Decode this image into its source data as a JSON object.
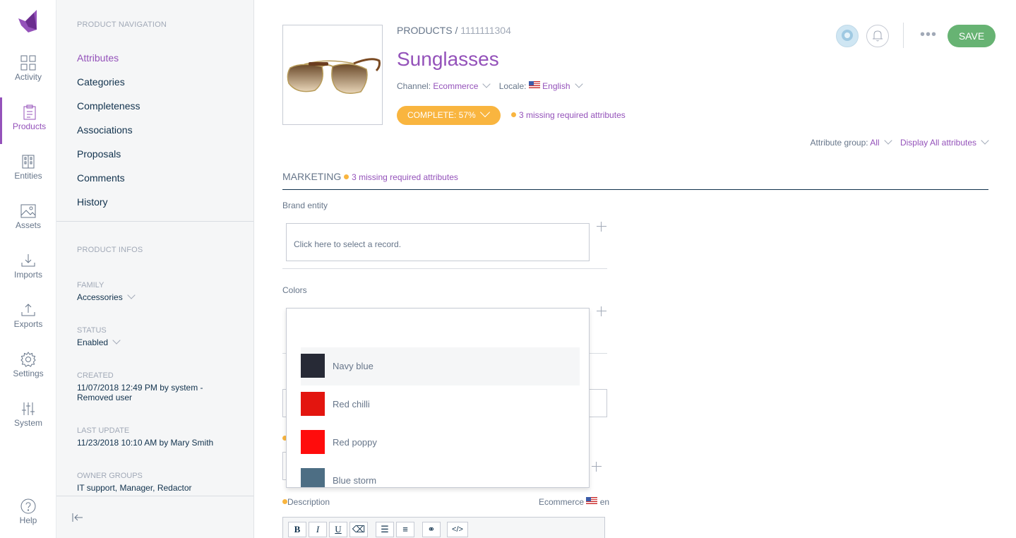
{
  "colors": {
    "accent": "#9452ba",
    "save": "#67b373",
    "warning": "#f9b53f",
    "text": "#67768a",
    "dark": "#11324d"
  },
  "mainmenu": {
    "items": [
      {
        "label": "Activity",
        "icon": "activity-icon"
      },
      {
        "label": "Products",
        "icon": "products-icon",
        "active": true
      },
      {
        "label": "Entities",
        "icon": "entities-icon"
      },
      {
        "label": "Assets",
        "icon": "assets-icon"
      },
      {
        "label": "Imports",
        "icon": "imports-icon"
      },
      {
        "label": "Exports",
        "icon": "exports-icon"
      },
      {
        "label": "Settings",
        "icon": "settings-icon"
      },
      {
        "label": "System",
        "icon": "system-icon"
      }
    ],
    "help": "Help"
  },
  "column": {
    "nav_title": "PRODUCT NAVIGATION",
    "nav": [
      "Attributes",
      "Categories",
      "Completeness",
      "Associations",
      "Proposals",
      "Comments",
      "History"
    ],
    "infos_title": "PRODUCT INFOS",
    "family_label": "FAMILY",
    "family_value": "Accessories",
    "status_label": "STATUS",
    "status_value": "Enabled",
    "created_label": "CREATED",
    "created_value": "11/07/2018 12:49 PM by system - Removed user",
    "updated_label": "LAST UPDATE",
    "updated_value": "11/23/2018 10:10 AM by Mary Smith",
    "owner_label": "OWNER GROUPS",
    "owner_value": "IT support, Manager, Redactor"
  },
  "header": {
    "breadcrumb_root": "PRODUCTS",
    "breadcrumb_sep": " / ",
    "breadcrumb_id": "1111111304",
    "title": "Sunglasses",
    "channel_label": "Channel:",
    "channel_value": "Ecommerce",
    "locale_label": "Locale:",
    "locale_value": "English",
    "complete_label": "COMPLETE: 57%",
    "completeness": 57,
    "missing": "3 missing required attributes",
    "save": "SAVE",
    "more": "•••"
  },
  "filters": {
    "group_label": "Attribute group:",
    "group_value": "All",
    "display_value": "Display All attributes"
  },
  "section": {
    "title": "MARKETING",
    "missing": "3 missing required attributes"
  },
  "fields": {
    "brand_label": "Brand entity",
    "brand_placeholder": "Click here to select a record.",
    "colors_label": "Colors",
    "description_label": "Description",
    "description_channel": "Ecommerce",
    "description_locale": "en"
  },
  "color_options": [
    {
      "name": "Navy blue",
      "color": "#272a36"
    },
    {
      "name": "Red chilli",
      "color": "#e3150f"
    },
    {
      "name": "Red poppy",
      "color": "#ff0c0c"
    },
    {
      "name": "Blue storm",
      "color": "#4d6e84"
    }
  ],
  "toolbar": [
    {
      "glyph": "B",
      "name": "bold-icon"
    },
    {
      "glyph": "I",
      "name": "italic-icon"
    },
    {
      "glyph": "U",
      "name": "underline-icon"
    },
    {
      "glyph": "⌫",
      "name": "eraser-icon"
    },
    {
      "glyph": "☰",
      "name": "bullet-list-icon"
    },
    {
      "glyph": "≡",
      "name": "numbered-list-icon"
    },
    {
      "glyph": "⚭",
      "name": "link-icon"
    },
    {
      "glyph": "</>",
      "name": "code-icon"
    }
  ]
}
